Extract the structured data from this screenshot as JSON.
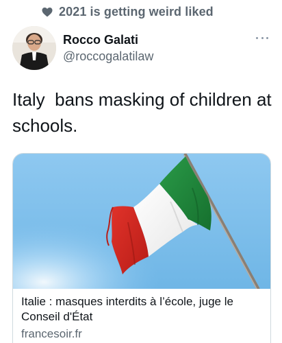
{
  "context": {
    "label": "2021 is getting weird liked",
    "icon": "heart-icon"
  },
  "author": {
    "name": "Rocco Galati",
    "handle": "@roccogalatilaw"
  },
  "tweet": {
    "text": "Italy  bans masking of children at schools."
  },
  "card": {
    "title": "Italie : masques interdits à l’école, juge le Conseil d'État",
    "domain": "francesoir.fr",
    "image": "italian-flag-photo"
  },
  "colors": {
    "text": "#0f1419",
    "secondary": "#5b6670",
    "border": "#cfd9de",
    "flag_green": "#1f8a3b",
    "flag_red": "#d7261e",
    "sky": "#7fc0ec"
  }
}
